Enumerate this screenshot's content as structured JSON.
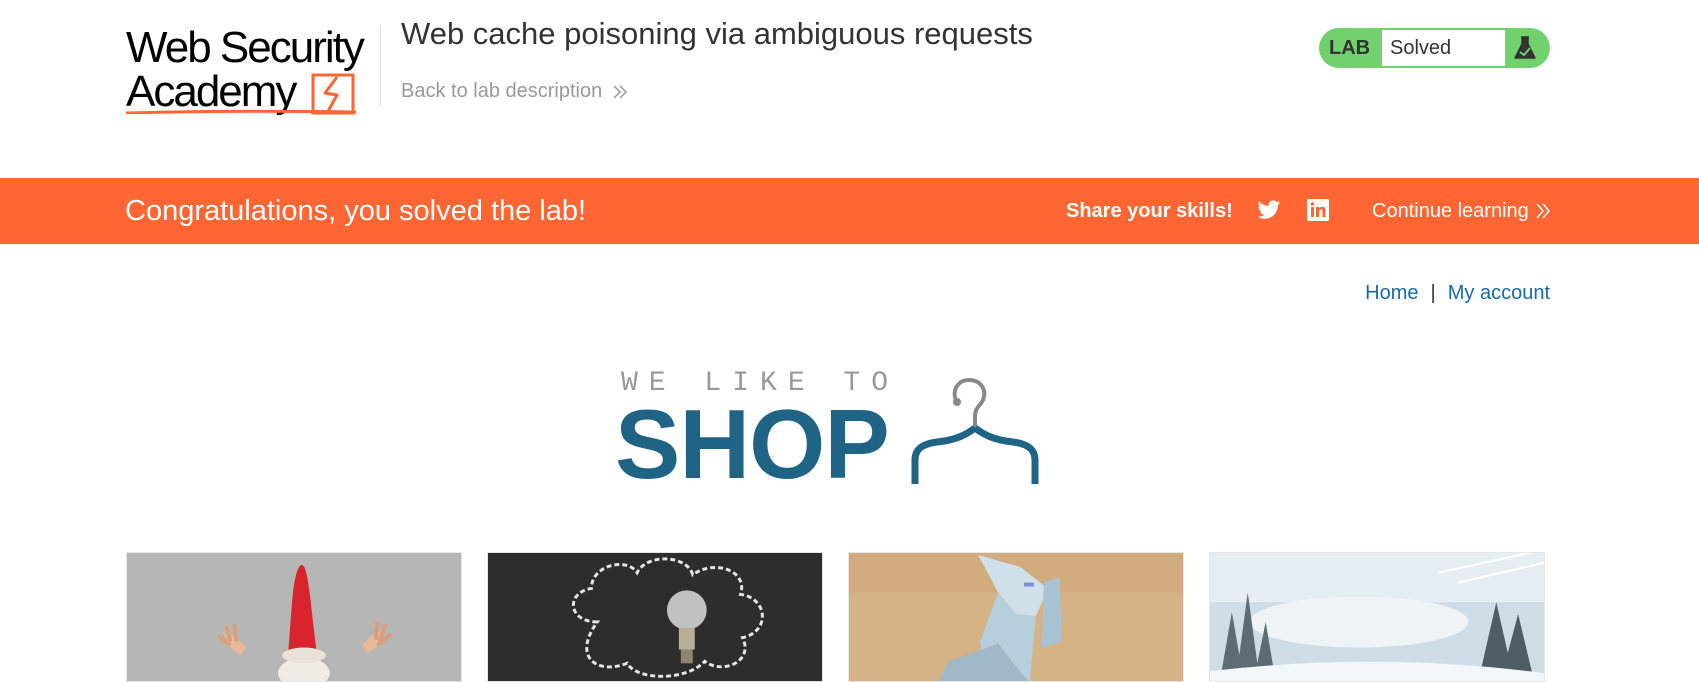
{
  "logo": {
    "line1": "Web Security",
    "line2": "Academy"
  },
  "header": {
    "title": "Web cache poisoning via ambiguous requests",
    "back_link": "Back to lab description",
    "lab_label": "LAB",
    "lab_status": "Solved"
  },
  "banner": {
    "message": "Congratulations, you solved the lab!",
    "share": "Share your skills!",
    "continue": "Continue learning"
  },
  "nav": {
    "home": "Home",
    "separator": "|",
    "account": "My account"
  },
  "shop_logo": {
    "tagline": "WE LIKE TO",
    "word": "SHOP"
  },
  "products": [
    {
      "image": "garden-gnome-image"
    },
    {
      "image": "light-bulb-chalk-cloud-image"
    },
    {
      "image": "origami-paper-image"
    },
    {
      "image": "snowy-forest-image"
    }
  ],
  "colors": {
    "accent_orange": "#ff6633",
    "lab_green": "#70d16d",
    "link_blue": "#1a6aa8",
    "shop_blue": "#1f6485"
  }
}
